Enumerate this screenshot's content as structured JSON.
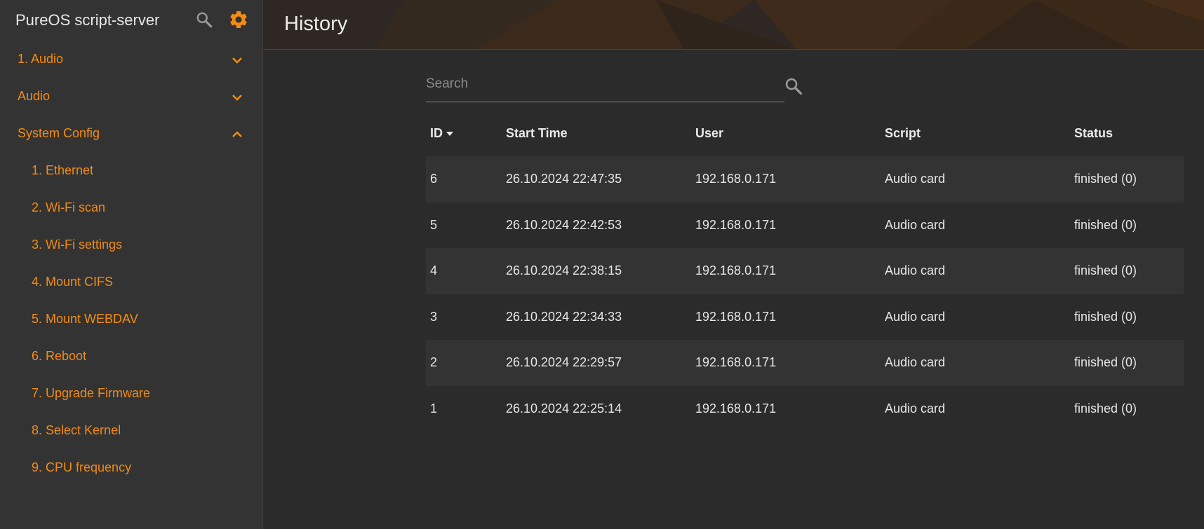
{
  "app": {
    "title": "PureOS script-server"
  },
  "colors": {
    "accent": "#f28c15",
    "sidebar_bg": "#333333",
    "content_bg": "#2b2b2b"
  },
  "icons": {
    "search": "search-icon",
    "settings": "gear-icon"
  },
  "sidebar": {
    "groups": [
      {
        "label": "1. Audio",
        "expanded": false
      },
      {
        "label": "Audio",
        "expanded": false
      },
      {
        "label": "System Config",
        "expanded": true
      }
    ],
    "items": [
      {
        "label": "1. Ethernet"
      },
      {
        "label": "2. Wi-Fi scan"
      },
      {
        "label": "3. Wi-Fi settings"
      },
      {
        "label": "4. Mount CIFS"
      },
      {
        "label": "5. Mount WEBDAV"
      },
      {
        "label": "6. Reboot"
      },
      {
        "label": "7. Upgrade Firmware"
      },
      {
        "label": "8. Select Kernel"
      },
      {
        "label": "9. CPU frequency"
      }
    ]
  },
  "header": {
    "title": "History"
  },
  "search": {
    "placeholder": "Search",
    "value": ""
  },
  "table": {
    "columns": [
      "ID",
      "Start Time",
      "User",
      "Script",
      "Status"
    ],
    "sorted_by": "ID",
    "rows": [
      [
        "6",
        "26.10.2024 22:47:35",
        "192.168.0.171",
        "Audio card",
        "finished (0)"
      ],
      [
        "5",
        "26.10.2024 22:42:53",
        "192.168.0.171",
        "Audio card",
        "finished (0)"
      ],
      [
        "4",
        "26.10.2024 22:38:15",
        "192.168.0.171",
        "Audio card",
        "finished (0)"
      ],
      [
        "3",
        "26.10.2024 22:34:33",
        "192.168.0.171",
        "Audio card",
        "finished (0)"
      ],
      [
        "2",
        "26.10.2024 22:29:57",
        "192.168.0.171",
        "Audio card",
        "finished (0)"
      ],
      [
        "1",
        "26.10.2024 22:25:14",
        "192.168.0.171",
        "Audio card",
        "finished (0)"
      ]
    ]
  }
}
